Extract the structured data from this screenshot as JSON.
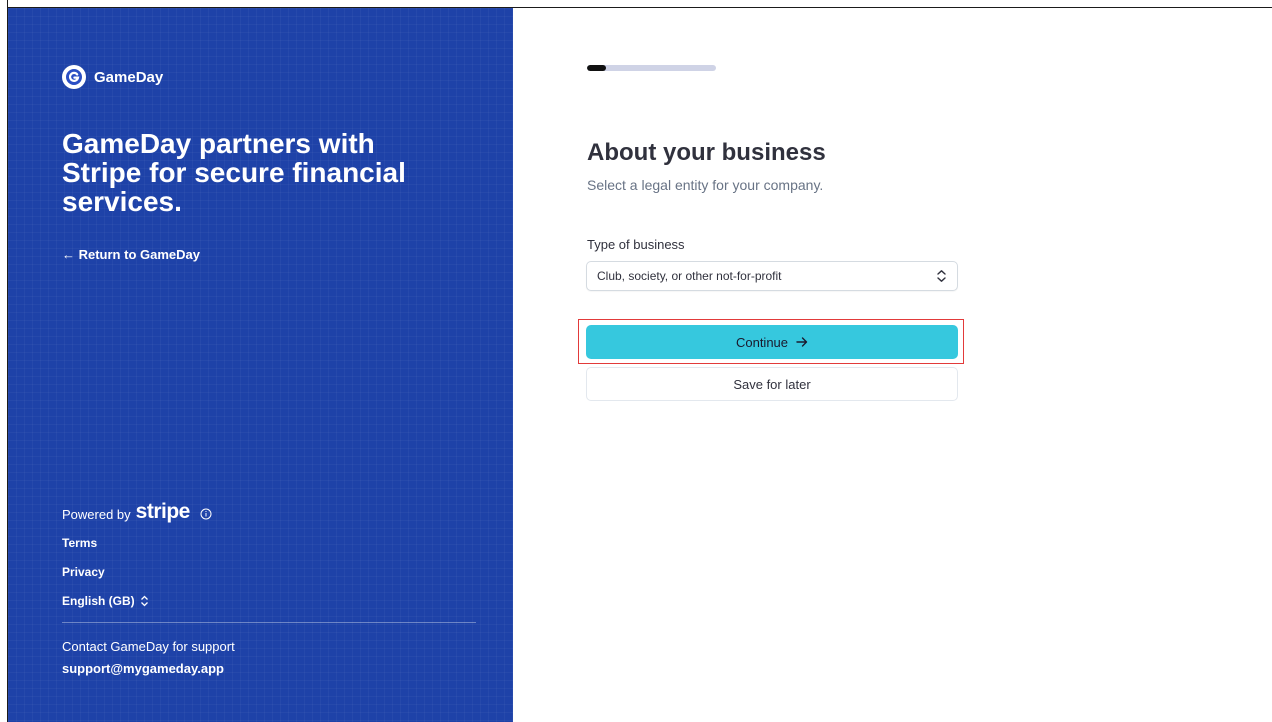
{
  "brand": {
    "name": "GameDay",
    "logo_icon": "gameday-logo-icon"
  },
  "left_panel": {
    "headline": "GameDay partners with Stripe for secure financial services.",
    "return_link": "← Return to GameDay",
    "powered_by_label": "Powered by",
    "powered_by_brand": "stripe",
    "terms": "Terms",
    "privacy": "Privacy",
    "language": "English (GB)",
    "support_text": "Contact GameDay for support",
    "support_email": "support@mygameday.app",
    "background_color": "#1e42a8"
  },
  "main": {
    "progress_fraction": 0.15,
    "title": "About your business",
    "subtitle": "Select a legal entity for your company.",
    "business_type_label": "Type of business",
    "business_type_value": "Club, society, or other not-for-profit",
    "continue_label": "Continue",
    "save_label": "Save for later",
    "accent_color": "#36c8de",
    "highlight_color": "#e23a3a"
  }
}
